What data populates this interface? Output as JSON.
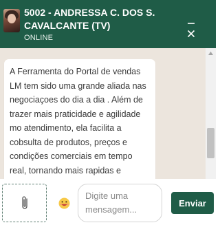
{
  "header": {
    "title": "5002 - ANDRESSA C. DOS S. CAVALCANTE (TV)",
    "status": "ONLINE",
    "background": "#1f5c47",
    "minimize_icon": "minus-icon",
    "close_icon": "close-icon"
  },
  "chat": {
    "background": "#ece5dd",
    "message": "A Ferramenta do Portal de vendas LM tem sido uma grande aliada nas negociaçoes do dia a dia . Além de trazer mais praticidade e agilidade mo atendimento, ela facilita a cobsulta de produtos, preços e condições comerciais em tempo real, tornando mais rapidas e efecientes"
  },
  "composer": {
    "attach_icon": "paperclip-icon",
    "emoji_icon": "emoji-icon",
    "placeholder": "Digite uma mensagem...",
    "value": "",
    "send_label": "Enviar",
    "accent": "#1f5c47"
  }
}
